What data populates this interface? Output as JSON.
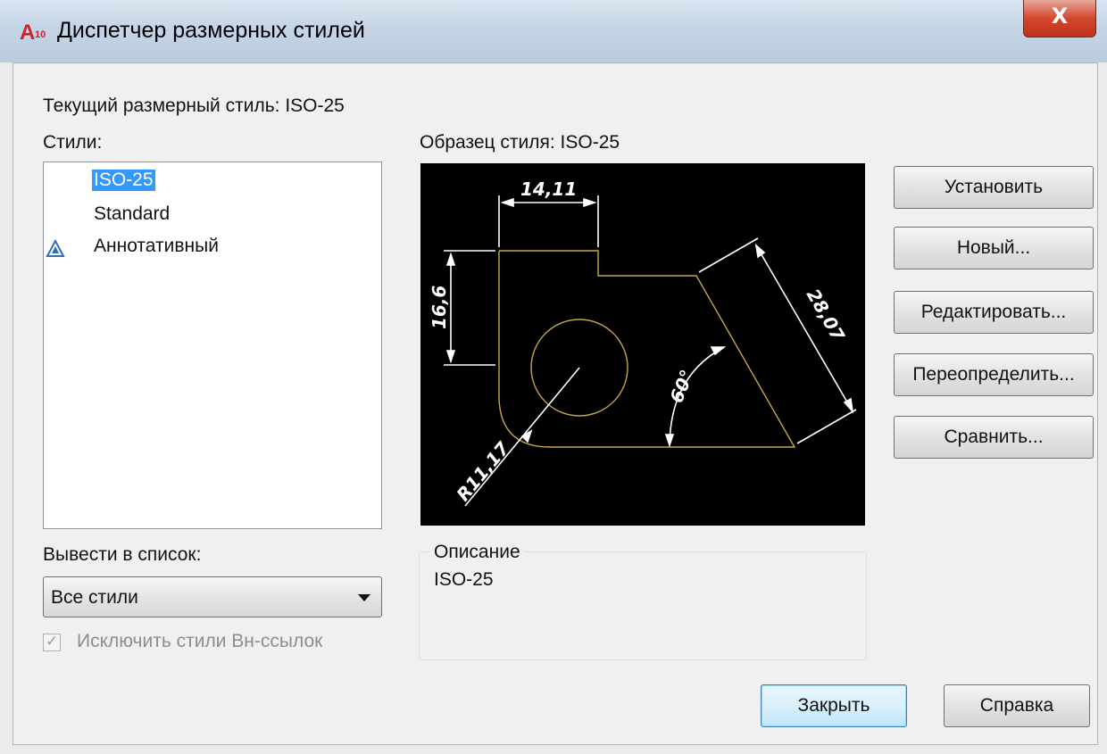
{
  "window": {
    "title": "Диспетчер размерных стилей",
    "app_icon": "autocad-icon",
    "close_label": "X"
  },
  "current_style": {
    "label": "Текущий размерный стиль: ISO-25"
  },
  "styles": {
    "label": "Стили:",
    "items": [
      {
        "label": "ISO-25",
        "selected": true,
        "icon": null
      },
      {
        "label": "Standard",
        "selected": false,
        "icon": null
      },
      {
        "label": "Аннотативный",
        "selected": false,
        "icon": "annotative-icon"
      }
    ]
  },
  "preview": {
    "label": "Образец стиля: ISO-25",
    "dims": {
      "top": "14,11",
      "left": "16,6",
      "diagonal": "28,07",
      "angle": "60°",
      "radius": "R11,17"
    },
    "colors": {
      "background": "#000000",
      "geometry": "#c8a64b",
      "dimensions": "#ffffff"
    }
  },
  "buttons": {
    "set_current": "Установить",
    "new": "Новый...",
    "modify": "Редактировать...",
    "override": "Переопределить...",
    "compare": "Сравнить...",
    "close": "Закрыть",
    "help": "Справка"
  },
  "list_filter": {
    "label": "Вывести в список:",
    "selected": "Все стили"
  },
  "exclude_xref": {
    "label": "Исключить стили Вн-ссылок",
    "checked": true,
    "disabled": true
  },
  "description": {
    "title": "Описание",
    "text": "ISO-25"
  }
}
